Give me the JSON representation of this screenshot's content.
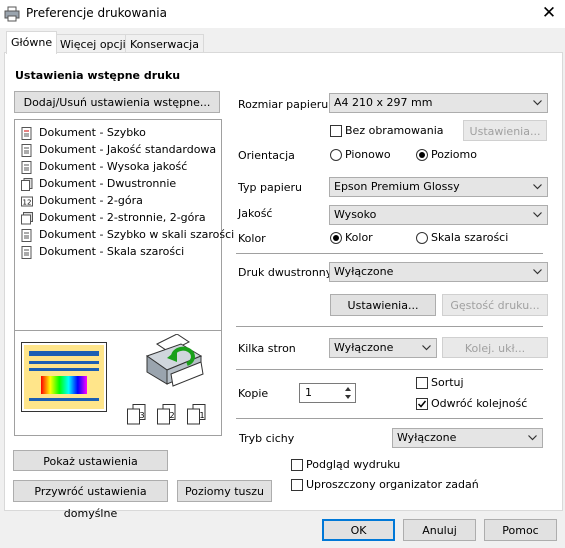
{
  "window": {
    "title": "Preferencje drukowania",
    "close_icon": "close-icon"
  },
  "tabs": [
    {
      "label": "Główne",
      "active": true
    },
    {
      "label": "Więcej opcji",
      "active": false
    },
    {
      "label": "Konserwacja",
      "active": false
    }
  ],
  "presets": {
    "heading": "Ustawienia wstępne druku",
    "add_remove_button": "Dodaj/Usuń ustawienia wstępne...",
    "items": [
      "Dokument - Szybko",
      "Dokument - Jakość standardowa",
      "Dokument - Wysoka jakość",
      "Dokument - Dwustronnie",
      "Dokument - 2-góra",
      "Dokument - 2-stronnie, 2-góra",
      "Dokument - Szybko w skali szarości",
      "Dokument - Skala szarości"
    ],
    "show_settings_button": "Pokaż ustawienia",
    "restore_defaults_button": "Przywróć ustawienia domyślne",
    "ink_levels_button": "Poziomy tuszu"
  },
  "preview_page_numbers": [
    "3",
    "2",
    "1"
  ],
  "settings": {
    "paper_size": {
      "label": "Rozmiar papieru",
      "value": "A4 210 x 297 mm"
    },
    "borderless": {
      "label": "Bez obramowania",
      "checked": false,
      "settings_button": "Ustawienia..."
    },
    "orientation": {
      "label": "Orientacja",
      "options": [
        "Pionowo",
        "Poziomo"
      ],
      "selected": "Poziomo"
    },
    "paper_type": {
      "label": "Typ papieru",
      "value": "Epson Premium Glossy"
    },
    "quality": {
      "label": "Jakość",
      "value": "Wysoko"
    },
    "color": {
      "label": "Kolor",
      "options": [
        "Kolor",
        "Skala szarości"
      ],
      "selected": "Kolor"
    },
    "duplex": {
      "label": "Druk dwustronny",
      "value": "Wyłączone",
      "settings_button": "Ustawienia...",
      "density_button": "Gęstość druku..."
    },
    "multipage": {
      "label": "Kilka stron",
      "value": "Wyłączone",
      "order_button": "Kolej. ukł..."
    },
    "copies": {
      "label": "Kopie",
      "value": "1",
      "collate_label": "Sortuj",
      "collate": false,
      "reverse_label": "Odwróć kolejność",
      "reverse": true
    },
    "quiet_mode": {
      "label": "Tryb cichy",
      "value": "Wyłączone"
    },
    "print_preview": {
      "label": "Podgląd wydruku",
      "checked": false
    },
    "job_arranger": {
      "label": "Uproszczony organizator zadań",
      "checked": false
    }
  },
  "footer": {
    "ok": "OK",
    "cancel": "Anuluj",
    "help": "Pomoc"
  },
  "colors": {
    "accent": "#0078d7"
  }
}
